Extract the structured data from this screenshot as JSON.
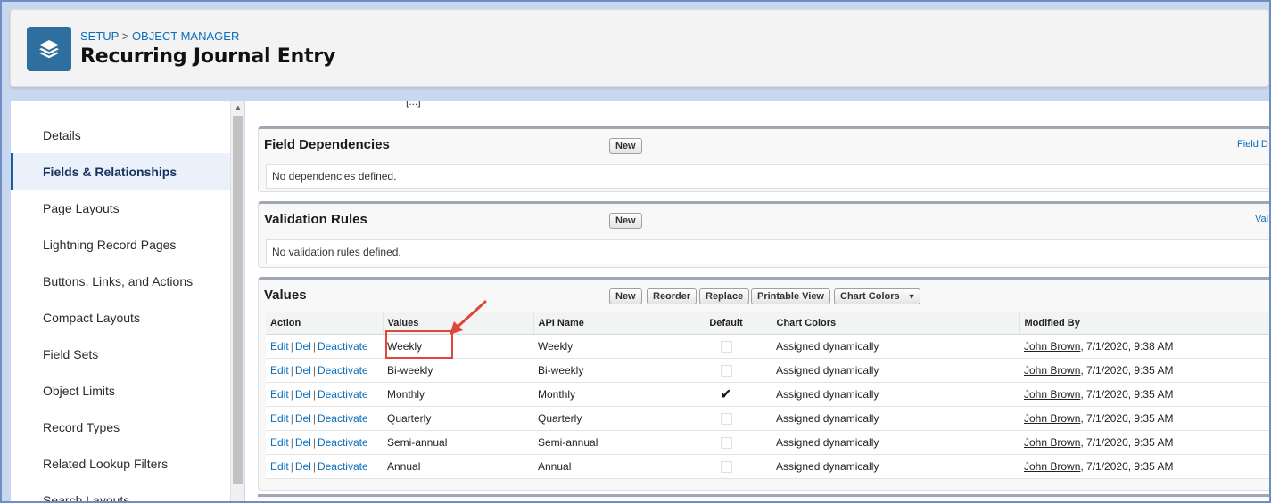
{
  "header": {
    "breadcrumb_setup": "SETUP",
    "breadcrumb_sep": " > ",
    "breadcrumb_object_manager": "OBJECT MANAGER",
    "title": "Recurring Journal Entry",
    "icon": "layers-icon",
    "icon_color": "#2f6f9f"
  },
  "sidebar": {
    "items": [
      {
        "label": "Details"
      },
      {
        "label": "Fields & Relationships"
      },
      {
        "label": "Page Layouts"
      },
      {
        "label": "Lightning Record Pages"
      },
      {
        "label": "Buttons, Links, and Actions"
      },
      {
        "label": "Compact Layouts"
      },
      {
        "label": "Field Sets"
      },
      {
        "label": "Object Limits"
      },
      {
        "label": "Record Types"
      },
      {
        "label": "Related Lookup Filters"
      },
      {
        "label": "Search Layouts"
      }
    ],
    "active_index": 1
  },
  "content": {
    "clipped_text": "[...]",
    "field_dependencies": {
      "title": "Field Dependencies",
      "new_label": "New",
      "link": "Field D",
      "empty": "No dependencies defined."
    },
    "validation_rules": {
      "title": "Validation Rules",
      "new_label": "New",
      "link": "Val",
      "empty": "No validation rules defined."
    },
    "values": {
      "title": "Values",
      "buttons": {
        "new": "New",
        "reorder": "Reorder",
        "replace": "Replace",
        "printable_view": "Printable View",
        "chart_colors": "Chart Colors"
      },
      "columns": [
        "Action",
        "Values",
        "API Name",
        "Default",
        "Chart Colors",
        "Modified By"
      ],
      "action_edit": "Edit",
      "action_del": "Del",
      "action_deactivate": "Deactivate",
      "action_sep": "|",
      "rows": [
        {
          "value": "Weekly",
          "api": "Weekly",
          "default": false,
          "chart": "Assigned dynamically",
          "user": "John Brown",
          "date": ", 7/1/2020, 9:38 AM"
        },
        {
          "value": "Bi-weekly",
          "api": "Bi-weekly",
          "default": false,
          "chart": "Assigned dynamically",
          "user": "John Brown",
          "date": ", 7/1/2020, 9:35 AM"
        },
        {
          "value": "Monthly",
          "api": "Monthly",
          "default": true,
          "chart": "Assigned dynamically",
          "user": "John Brown",
          "date": ", 7/1/2020, 9:35 AM"
        },
        {
          "value": "Quarterly",
          "api": "Quarterly",
          "default": false,
          "chart": "Assigned dynamically",
          "user": "John Brown",
          "date": ", 7/1/2020, 9:35 AM"
        },
        {
          "value": "Semi-annual",
          "api": "Semi-annual",
          "default": false,
          "chart": "Assigned dynamically",
          "user": "John Brown",
          "date": ", 7/1/2020, 9:35 AM"
        },
        {
          "value": "Annual",
          "api": "Annual",
          "default": false,
          "chart": "Assigned dynamically",
          "user": "John Brown",
          "date": ", 7/1/2020, 9:35 AM"
        }
      ]
    }
  },
  "annotation": {
    "color": "#e0473b"
  }
}
